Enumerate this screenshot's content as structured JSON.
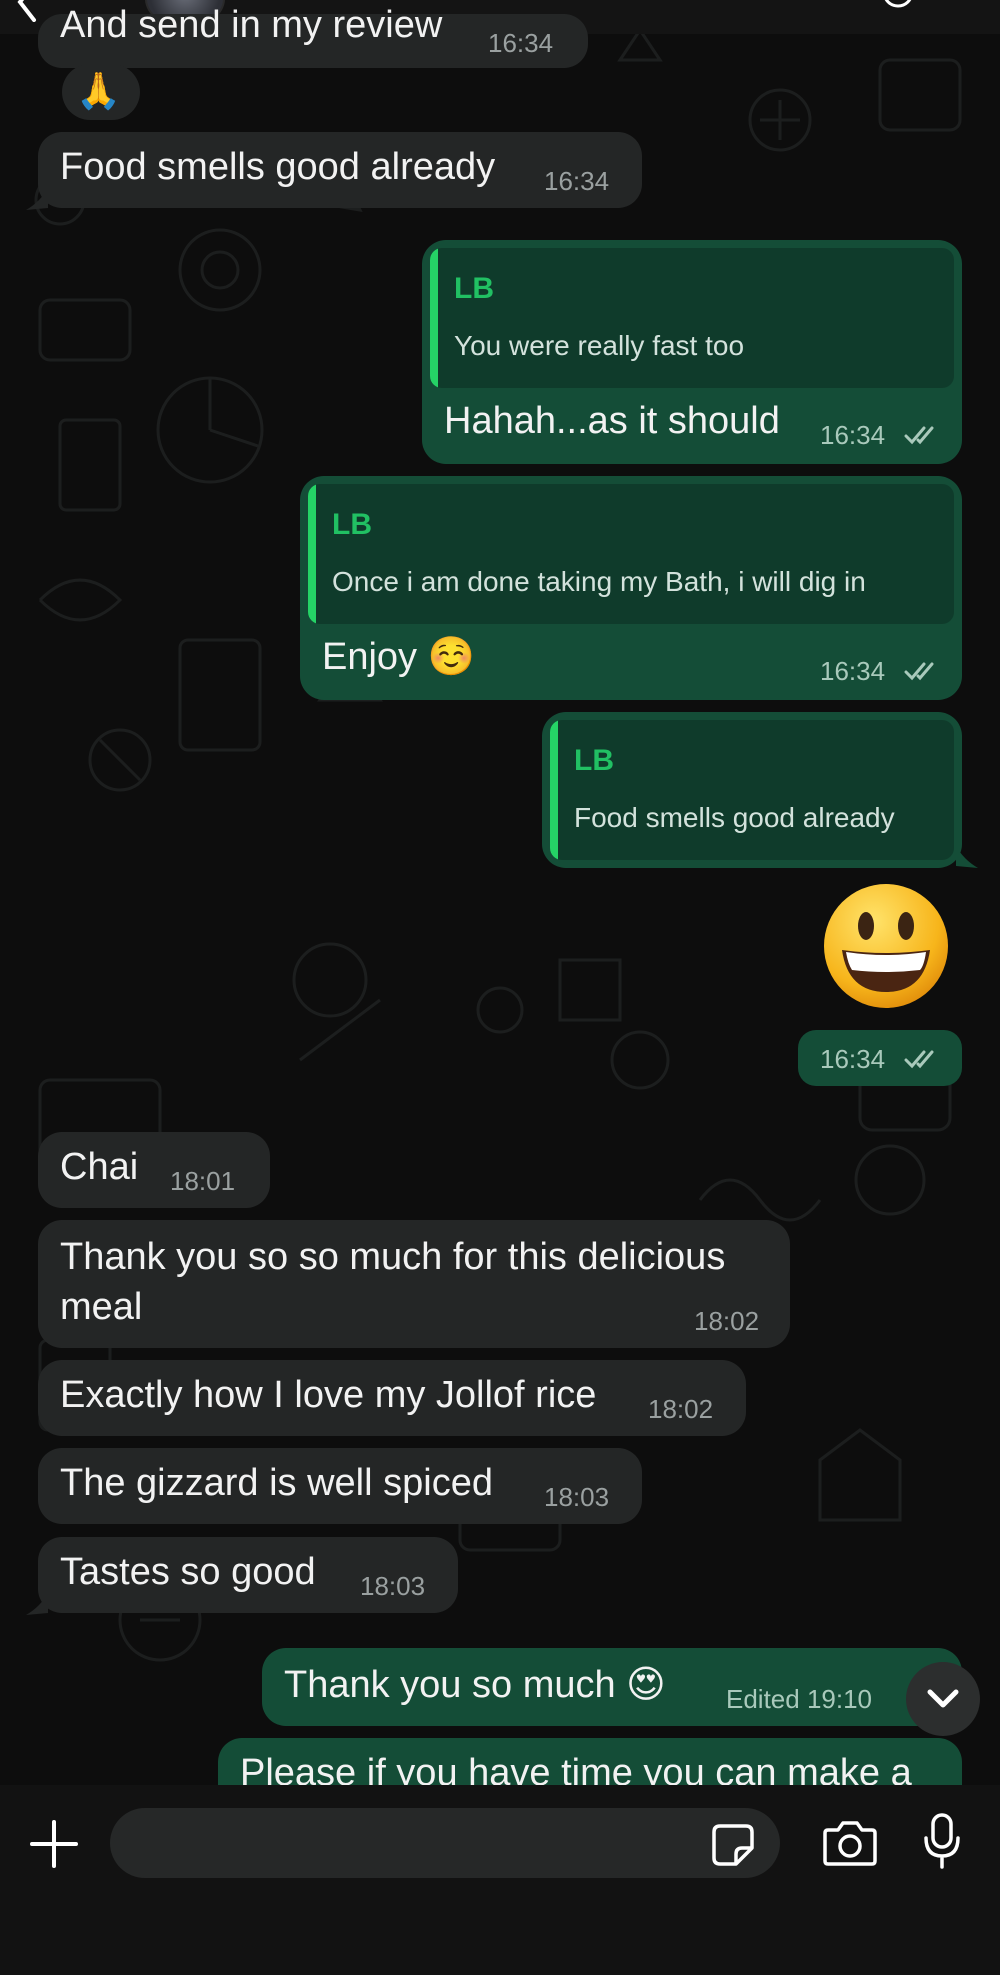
{
  "messages": [
    {
      "type": "in",
      "text": "And send in my review",
      "time": "16:34"
    },
    {
      "type": "in",
      "emoji": "🙏"
    },
    {
      "type": "in",
      "text": "Food smells good already",
      "time": "16:34"
    },
    {
      "type": "out",
      "quote_author": "LB",
      "quote_text": "You were really fast too",
      "text": "Hahah...as it should",
      "time": "16:34"
    },
    {
      "type": "out",
      "quote_author": "LB",
      "quote_text": "Once i am done taking my Bath, i will dig in",
      "text": "Enjoy ☺️",
      "time": "16:34"
    },
    {
      "type": "out",
      "quote_author": "LB",
      "quote_text": "Food smells good already"
    },
    {
      "type": "out",
      "emoji": "😃",
      "time": "16:34"
    },
    {
      "type": "in",
      "text": "Chai",
      "time": "18:01"
    },
    {
      "type": "in",
      "text_lines": [
        "Thank you so so much for this delicious",
        "meal"
      ],
      "time": "18:02"
    },
    {
      "type": "in",
      "text": "Exactly how I love my Jollof rice",
      "time": "18:02"
    },
    {
      "type": "in",
      "text": "The gizzard is well spiced",
      "time": "18:03"
    },
    {
      "type": "in",
      "text": "Tastes so good",
      "time": "18:03"
    },
    {
      "type": "out",
      "text": "Thank you so much 😍",
      "time": "Edited 19:10"
    },
    {
      "type": "out",
      "text": "Please if you have time you can make a"
    }
  ],
  "icons": {
    "read_receipt": "double-check-icon",
    "scroll_down": "chevron-down-icon",
    "add": "plus-icon",
    "sticker": "sticker-icon",
    "camera": "camera-icon",
    "mic": "microphone-icon"
  },
  "colors": {
    "incoming": "#242626",
    "outgoing": "#144d37",
    "quote_accent": "#25d366",
    "background": "#0d0d0d"
  }
}
